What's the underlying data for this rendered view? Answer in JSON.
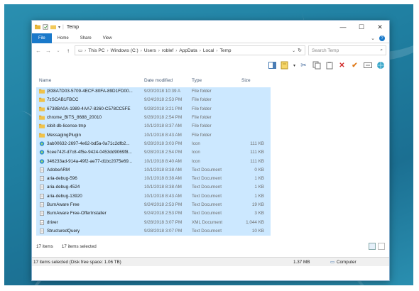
{
  "window": {
    "title": "Temp",
    "controls": {
      "minimize": "—",
      "maximize": "☐",
      "close": "✕"
    }
  },
  "ribbon": {
    "tabs": [
      "File",
      "Home",
      "Share",
      "View"
    ],
    "expand": "⌄",
    "help": "?"
  },
  "address": {
    "crumbs": [
      "This PC",
      "Windows (C:)",
      "Users",
      "roblef",
      "AppData",
      "Local",
      "Temp"
    ],
    "search_placeholder": "Search Temp"
  },
  "columns": {
    "name": "Name",
    "date": "Date modified",
    "type": "Type",
    "size": "Size"
  },
  "files": [
    {
      "name": "{838A7D03-5709-4ECF-80FA-89D1FD00...",
      "date": "9/20/2018 10:39 A",
      "type": "File folder",
      "size": "",
      "icon": "folder"
    },
    {
      "name": "7zSCAB1FBCC",
      "date": "9/24/2018 2:53 PM",
      "type": "File folder",
      "size": "",
      "icon": "folder"
    },
    {
      "name": "6738BA0A-1989-4AA7-8260-C578CC5FE",
      "date": "9/28/2018 3:21 PM",
      "type": "File folder",
      "size": "",
      "icon": "folder"
    },
    {
      "name": "chrome_BITS_8688_20010",
      "date": "9/28/2018 2:54 PM",
      "type": "File folder",
      "size": "",
      "icon": "folder"
    },
    {
      "name": "iobit-db-license-tmp",
      "date": "10/1/2018 8:37 AM",
      "type": "File folder",
      "size": "",
      "icon": "folder"
    },
    {
      "name": "MessagingPlugin",
      "date": "10/1/2018 8:43 AM",
      "type": "File folder",
      "size": "",
      "icon": "folder"
    },
    {
      "name": "3ab00632-2697-4e62-bd5a-0a71c2dfb2...",
      "date": "9/28/2018 3:03 PM",
      "type": "Icon",
      "size": "111 KB",
      "icon": "ico"
    },
    {
      "name": "5cee742f-d7c8-4f5e-9424-0453dd9069f8...",
      "date": "9/28/2018 2:54 PM",
      "type": "Icon",
      "size": "111 KB",
      "icon": "ico"
    },
    {
      "name": "346233ad-914a-49f2-ae77-d1bc2075e69...",
      "date": "10/1/2018 8:40 AM",
      "type": "Icon",
      "size": "111 KB",
      "icon": "ico"
    },
    {
      "name": "AdobeARM",
      "date": "10/1/2018 8:38 AM",
      "type": "Text Document",
      "size": "0 KB",
      "icon": "txt"
    },
    {
      "name": "aria-debug-596",
      "date": "10/1/2018 8:38 AM",
      "type": "Text Document",
      "size": "1 KB",
      "icon": "txt"
    },
    {
      "name": "aria-debug-4524",
      "date": "10/1/2018 8:38 AM",
      "type": "Text Document",
      "size": "1 KB",
      "icon": "txt"
    },
    {
      "name": "aria-debug-13920",
      "date": "10/1/2018 8:43 AM",
      "type": "Text Document",
      "size": "1 KB",
      "icon": "txt"
    },
    {
      "name": "BurnAware Free",
      "date": "9/24/2018 2:53 PM",
      "type": "Text Document",
      "size": "19 KB",
      "icon": "txt"
    },
    {
      "name": "BurnAware Free-OfferInstaller",
      "date": "9/24/2018 2:53 PM",
      "type": "Text Document",
      "size": "3 KB",
      "icon": "txt"
    },
    {
      "name": "driver",
      "date": "9/28/2018 3:07 PM",
      "type": "XML Document",
      "size": "1,044 KB",
      "icon": "xml"
    },
    {
      "name": "StructuredQuery",
      "date": "9/28/2018 3:07 PM",
      "type": "Text Document",
      "size": "10 KB",
      "icon": "txt"
    }
  ],
  "status": {
    "items": "17 items",
    "selected": "17 items selected"
  },
  "bottom": {
    "selection_info": "17 items selected (Disk free space: 1.06 TB)",
    "size": "1.37 MB",
    "location": "Computer"
  }
}
